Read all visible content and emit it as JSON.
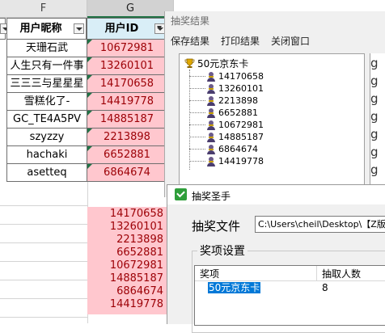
{
  "spreadsheet": {
    "columns": [
      "F",
      "G"
    ],
    "headers": {
      "nickname": "用户昵称",
      "user_id": "用户ID"
    },
    "rows": [
      {
        "nickname": "天珊石武",
        "user_id": "10672981"
      },
      {
        "nickname": "人生只有一件事",
        "user_id": "13260101"
      },
      {
        "nickname": "三三三与星星星",
        "user_id": "14170658"
      },
      {
        "nickname": "雪糕化了-",
        "user_id": "14419778"
      },
      {
        "nickname": "GC_TE4A5PV",
        "user_id": "14885187"
      },
      {
        "nickname": "szyzzy",
        "user_id": "2213898"
      },
      {
        "nickname": "hachaki",
        "user_id": "6652881"
      },
      {
        "nickname": "asetteq",
        "user_id": "6864674"
      }
    ],
    "extra_ids": [
      "14170658",
      "13260101",
      "2213898",
      "6652881",
      "10672981",
      "14885187",
      "6864674",
      "14419778"
    ],
    "colors": {
      "highlight_fill": "#ffc7ce",
      "highlight_text": "#9c0006",
      "accent": "#217346"
    }
  },
  "result_window": {
    "title": "抽奖结果",
    "menu": [
      "保存结果",
      "打印结果",
      "关闭窗口"
    ],
    "prize": "50元京东卡",
    "winners": [
      "14170658",
      "13260101",
      "2213898",
      "6652881",
      "10672981",
      "14885187",
      "6864674",
      "14419778"
    ],
    "right_glyphs": [
      "g",
      "g",
      "g",
      "g",
      "g",
      "g",
      "g"
    ]
  },
  "lottery_window": {
    "title": "抽奖圣手",
    "file_label": "抽奖文件",
    "file_path": "C:\\Users\\cheil\\Desktop\\【Z版三",
    "group_label": "奖项设置",
    "table_headers": {
      "prize": "奖项",
      "count": "抽取人数"
    },
    "prize_name": "50元京东卡",
    "prize_count": "8",
    "colors": {
      "selection": "#0078d7",
      "icon": "#2e9e3a"
    }
  }
}
